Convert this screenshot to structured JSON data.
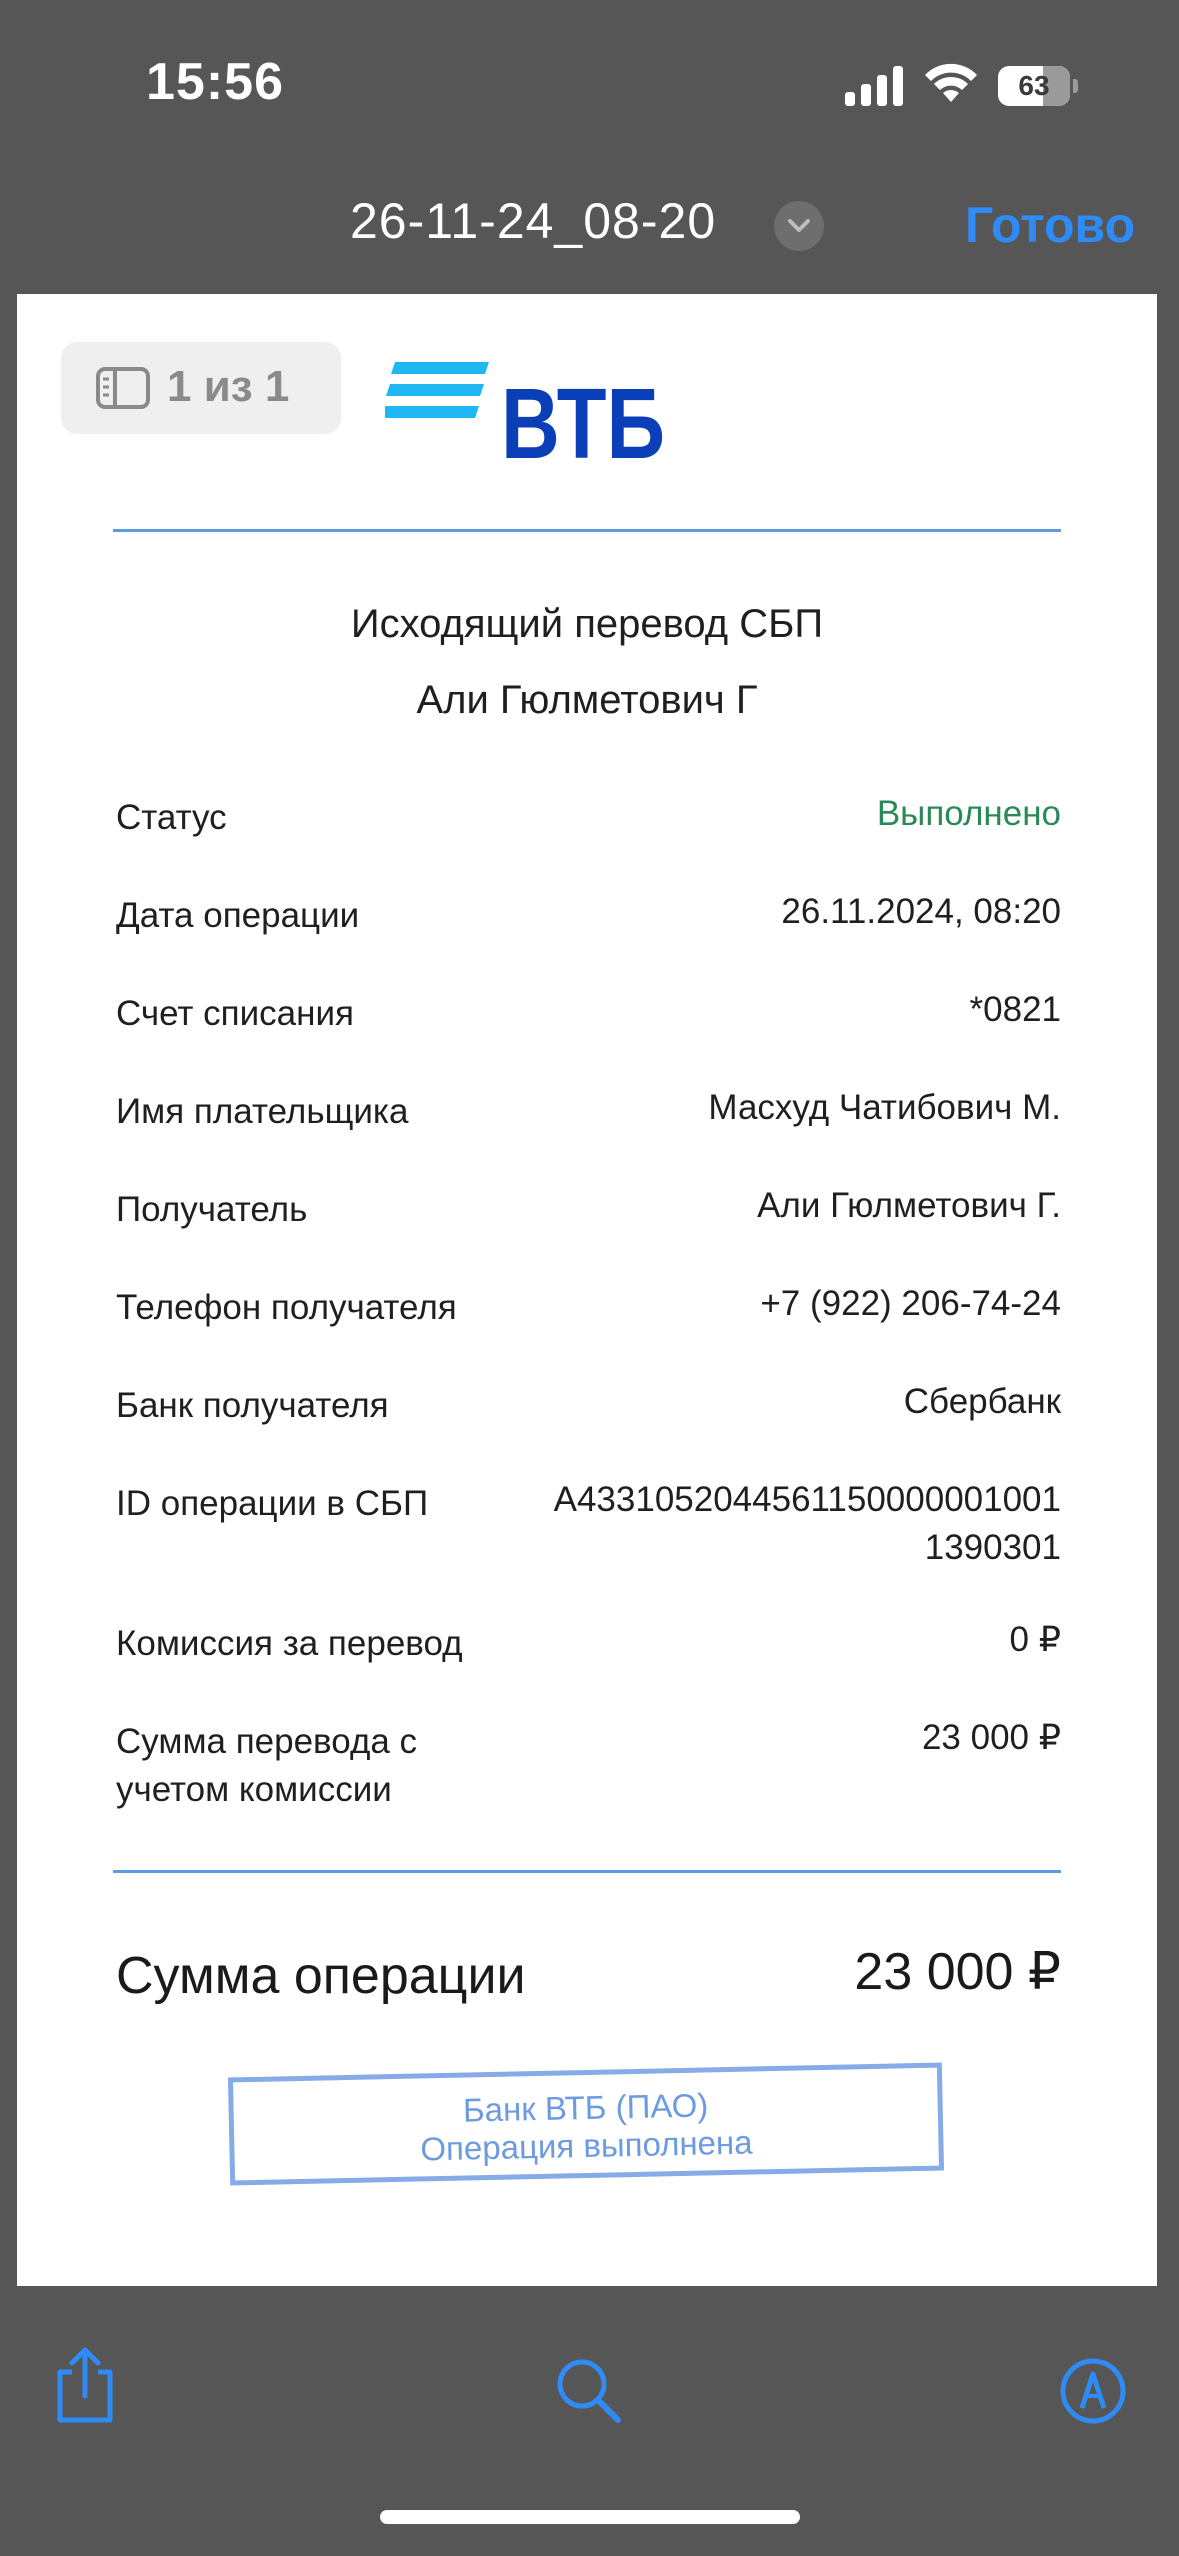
{
  "status_bar": {
    "time": "15:56",
    "battery_level": "63",
    "battery_fraction": 0.63
  },
  "title_bar": {
    "document_name": "26-11-24_08-20",
    "done_label": "Готово"
  },
  "page_counter": {
    "label": "1 из 1"
  },
  "receipt": {
    "logo_text": "ВТБ",
    "brand_color": "#0a3fb8",
    "brand_accent": "#1fb6f4",
    "title": "Исходящий перевод СБП",
    "recipient_heading": "Али Гюлметович Г",
    "rows": [
      {
        "label": "Статус",
        "value": "Выполнено"
      },
      {
        "label": "Дата операции",
        "value": "26.11.2024, 08:20"
      },
      {
        "label": "Счет списания",
        "value": "*0821"
      },
      {
        "label": "Имя плательщика",
        "value": "Масхуд Чатибович М."
      },
      {
        "label": "Получатель",
        "value": "Али Гюлметович Г."
      },
      {
        "label": "Телефон получателя",
        "value": "+7 (922) 206-74-24"
      },
      {
        "label": "Банк получателя",
        "value": "Сбербанк"
      },
      {
        "label": "ID операции в СБП",
        "value_line1": "A4331052044561150000001001",
        "value_line2": "1390301"
      },
      {
        "label": "Комиссия за перевод",
        "value": "0 ₽"
      },
      {
        "label_line1": "Сумма перевода с",
        "label_line2": "учетом комиссии",
        "value": "23 000 ₽"
      }
    ],
    "total_label": "Сумма операции",
    "total_value": "23 000 ₽",
    "stamp_line1": "Банк ВТБ (ПАО)",
    "stamp_line2": "Операция выполнена",
    "success_color": "#2a8a57"
  },
  "toolbar": {
    "icons": [
      "share-icon",
      "search-icon",
      "markup-icon"
    ],
    "accent": "#2f8bf5"
  }
}
